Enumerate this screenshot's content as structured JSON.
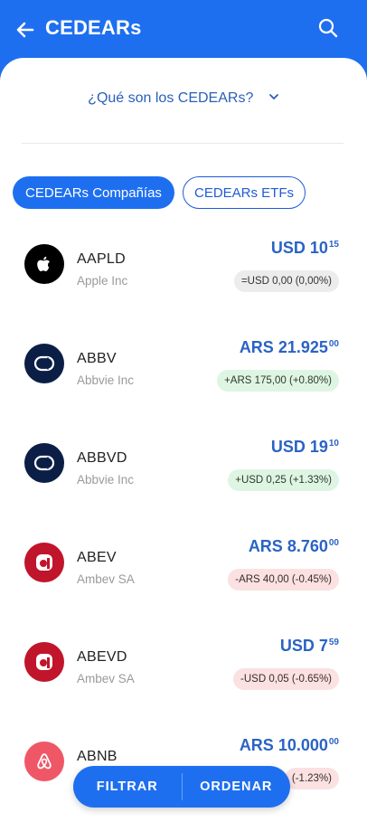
{
  "header": {
    "title": "CEDEARs",
    "back_icon": "arrow-left-icon",
    "search_icon": "search-icon"
  },
  "faq": {
    "label": "¿Qué son los CEDEARs?"
  },
  "chips": [
    {
      "label": "CEDEARs Compañías",
      "active": true
    },
    {
      "label": "CEDEARs ETFs",
      "active": false
    }
  ],
  "list": [
    {
      "ticker": "AAPLD",
      "company": "Apple Inc",
      "price_main": "USD 10",
      "price_dec": "15",
      "change": "=USD 0,00 (0,00%)",
      "trend": "neutral",
      "logo": "apple-logo-icon",
      "logo_color": "#000000"
    },
    {
      "ticker": "ABBV",
      "company": "Abbvie Inc",
      "price_main": "ARS 21.925",
      "price_dec": "00",
      "change": "+ARS 175,00 (+0.80%)",
      "trend": "up",
      "logo": "abbvie-logo-icon",
      "logo_color": "#0b1e45"
    },
    {
      "ticker": "ABBVD",
      "company": "Abbvie Inc",
      "price_main": "USD 19",
      "price_dec": "10",
      "change": "+USD 0,25 (+1.33%)",
      "trend": "up",
      "logo": "abbvie-logo-icon",
      "logo_color": "#0b1e45"
    },
    {
      "ticker": "ABEV",
      "company": "Ambev SA",
      "price_main": "ARS 8.760",
      "price_dec": "00",
      "change": "-ARS 40,00 (-0.45%)",
      "trend": "down",
      "logo": "ambev-logo-icon",
      "logo_color": "#c0152a"
    },
    {
      "ticker": "ABEVD",
      "company": "Ambev SA",
      "price_main": "USD 7",
      "price_dec": "59",
      "change": "-USD 0,05 (-0.65%)",
      "trend": "down",
      "logo": "ambev-logo-icon",
      "logo_color": "#c0152a"
    },
    {
      "ticker": "ABNB",
      "company": "",
      "price_main": "ARS 10.000",
      "price_dec": "00",
      "change": "(-1.23%)",
      "trend": "down",
      "logo": "airbnb-logo-icon",
      "logo_color": "#ef5767"
    }
  ],
  "fab": {
    "filter_label": "FILTRAR",
    "sort_label": "ORDENAR"
  },
  "colors": {
    "accent": "#1e6ff0",
    "price": "#2a63c4",
    "up_bg": "#dff5e3",
    "down_bg": "#fbe1e1",
    "neutral_bg": "#ececec"
  }
}
